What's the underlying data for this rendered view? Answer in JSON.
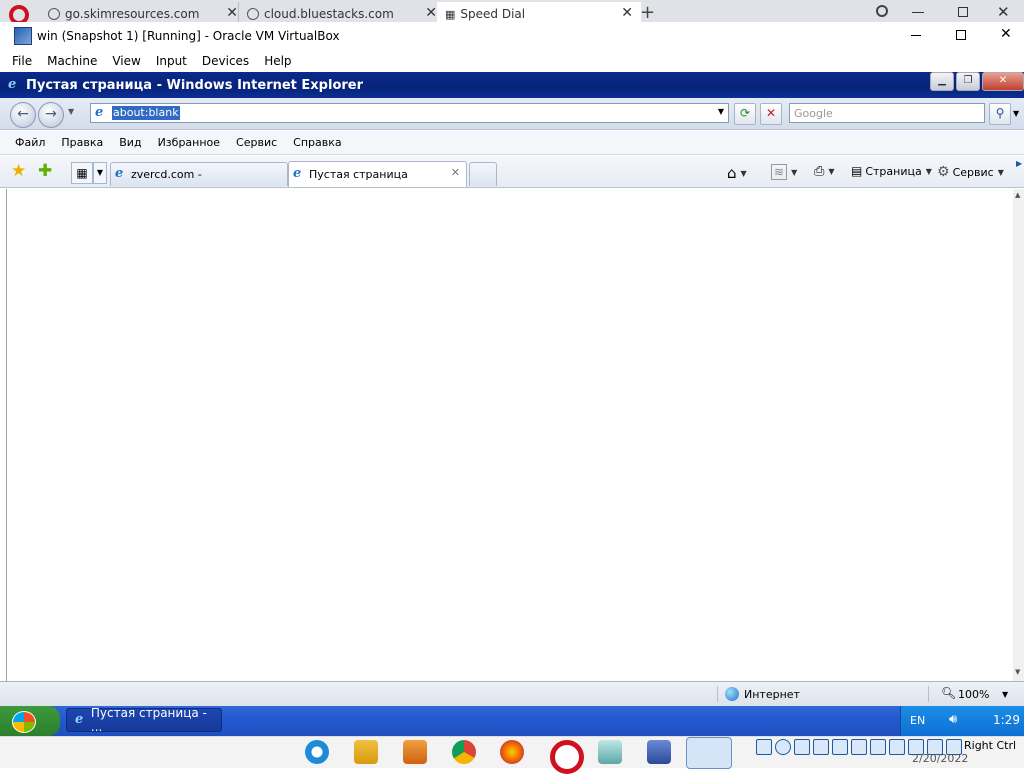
{
  "host_tabs": [
    {
      "label": "go.skimresources.com"
    },
    {
      "label": "cloud.bluestacks.com"
    },
    {
      "label": "Speed Dial"
    }
  ],
  "vbox": {
    "title": "win (Snapshot 1) [Running] - Oracle VM VirtualBox",
    "menu": [
      "File",
      "Machine",
      "View",
      "Input",
      "Devices",
      "Help"
    ],
    "host_key": "Right Ctrl",
    "date": "2/20/2022"
  },
  "ie": {
    "title": "Пустая страница - Windows Internet Explorer",
    "address": "about:blank",
    "search_placeholder": "Google",
    "menu": [
      "Файл",
      "Правка",
      "Вид",
      "Избранное",
      "Сервис",
      "Справка"
    ],
    "tabs": [
      {
        "label": "zvercd.com -"
      },
      {
        "label": "Пустая страница"
      }
    ],
    "toolbar": {
      "page_label": "Страница",
      "tools_label": "Сервис"
    },
    "status": {
      "zone": "Интернет",
      "zoom": "100%"
    }
  },
  "xp": {
    "task_label": "Пустая страница - ...",
    "lang": "EN",
    "clock": "1:29"
  },
  "colors": {
    "xp_blue": "#245ad0",
    "ie_title": "#0a2a8a",
    "selection": "#316ac5"
  }
}
